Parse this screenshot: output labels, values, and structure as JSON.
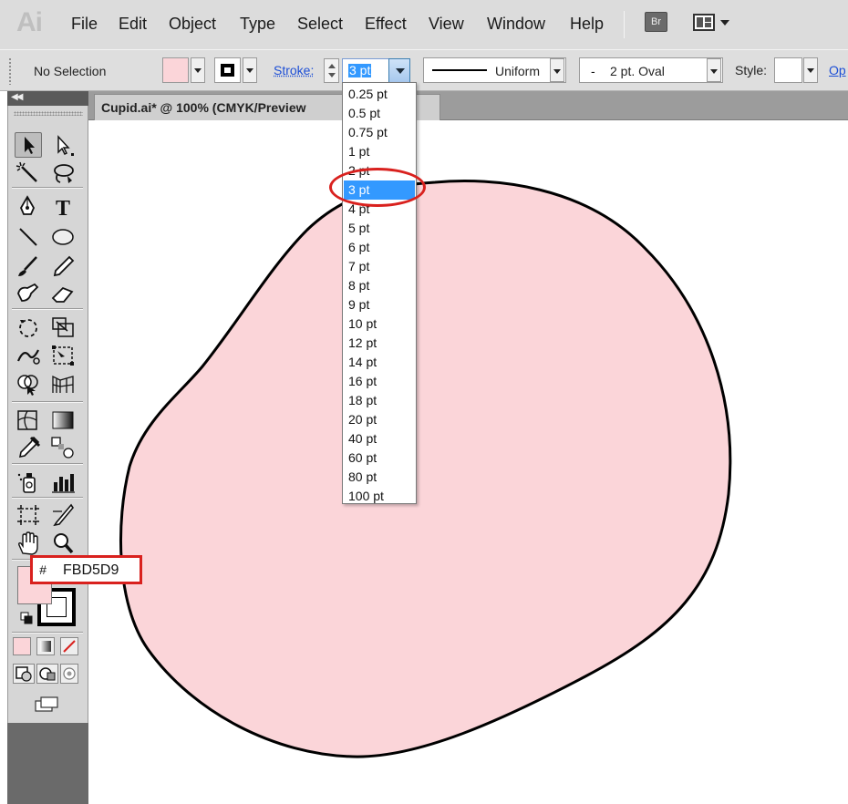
{
  "app": {
    "logo": "Ai"
  },
  "menu": {
    "items": [
      "File",
      "Edit",
      "Object",
      "Type",
      "Select",
      "Effect",
      "View",
      "Window",
      "Help"
    ],
    "bridge": "Br",
    "workspace_icon": "arrange-documents-icon"
  },
  "control_bar": {
    "selection_label": "No Selection",
    "fill_color": "#FBD5D9",
    "stroke_color": "#000000",
    "stroke_label": "Stroke:",
    "stroke_weight": "3 pt",
    "variable_width_profile": "Uniform",
    "brush_definition": "2 pt. Oval",
    "brush_dash": "-",
    "style_label": "Style:",
    "opacity_link": "Op"
  },
  "document": {
    "tab_title": "Cupid.ai* @ 100% (CMYK/Preview"
  },
  "stroke_dropdown": {
    "options": [
      "0.25 pt",
      "0.5 pt",
      "0.75 pt",
      "1 pt",
      "2 pt",
      "3 pt",
      "4 pt",
      "5 pt",
      "6 pt",
      "7 pt",
      "8 pt",
      "9 pt",
      "10 pt",
      "12 pt",
      "14 pt",
      "16 pt",
      "18 pt",
      "20 pt",
      "40 pt",
      "60 pt",
      "80 pt",
      "100 pt"
    ],
    "selected": "3 pt"
  },
  "color_callout": {
    "hash": "#",
    "hex": "FBD5D9"
  },
  "tools": {
    "icons": [
      "selection-tool-icon",
      "direct-selection-tool-icon",
      "magic-wand-icon",
      "lasso-icon",
      "pen-tool-icon",
      "type-tool-icon",
      "line-segment-icon",
      "ellipse-tool-icon",
      "paintbrush-icon",
      "pencil-icon",
      "blob-brush-icon",
      "eraser-icon",
      "rotate-tool-icon",
      "scale-tool-icon",
      "warp-tool-icon",
      "free-transform-icon",
      "shape-builder-icon",
      "perspective-grid-icon",
      "mesh-tool-icon",
      "gradient-tool-icon",
      "eyedropper-icon",
      "blend-tool-icon",
      "symbol-sprayer-icon",
      "column-graph-icon",
      "artboard-tool-icon",
      "slice-tool-icon",
      "hand-tool-icon",
      "zoom-tool-icon"
    ]
  },
  "colors": {
    "highlight": "#D9211E",
    "menu_bg": "#DCDCDC",
    "selection_blue": "#3399FF"
  }
}
